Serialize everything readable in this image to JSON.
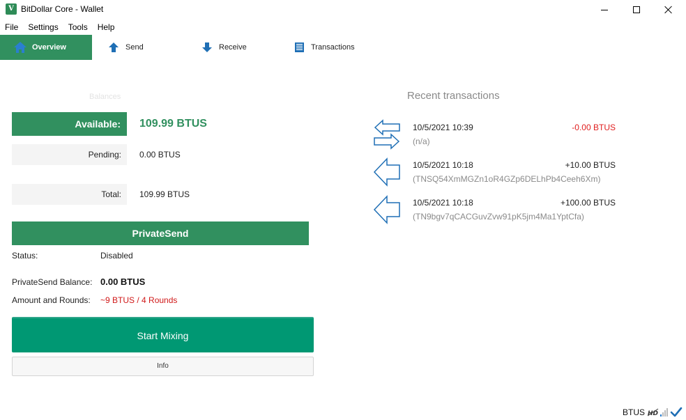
{
  "window": {
    "title": "BitDollar Core - Wallet",
    "app_icon_letter": "V"
  },
  "menu": {
    "items": [
      {
        "label": "File"
      },
      {
        "label": "Settings"
      },
      {
        "label": "Tools"
      },
      {
        "label": "Help"
      }
    ]
  },
  "toolbar": {
    "tabs": [
      {
        "label": "Overview",
        "icon": "home-icon",
        "active": true
      },
      {
        "label": "Send",
        "icon": "arrow-up-icon"
      },
      {
        "label": "Receive",
        "icon": "arrow-down-icon"
      },
      {
        "label": "Transactions",
        "icon": "list-icon"
      }
    ]
  },
  "balances": {
    "section_label": "Balances",
    "available_label": "Available:",
    "available_value": "109.99 BTUS",
    "pending_label": "Pending:",
    "pending_value": "0.00 BTUS",
    "total_label": "Total:",
    "total_value": "109.99 BTUS"
  },
  "privatesend": {
    "header": "PrivateSend",
    "status_label": "Status:",
    "status_value": "Disabled",
    "balance_label": "PrivateSend Balance:",
    "balance_value": "0.00 BTUS",
    "amount_rounds_label": "Amount and Rounds:",
    "amount_rounds_value": "~9 BTUS / 4 Rounds",
    "start_mixing_label": "Start Mixing",
    "info_label": "Info"
  },
  "recent": {
    "title": "Recent transactions",
    "transactions": [
      {
        "date": "10/5/2021 10:39",
        "amount": "-0.00 BTUS",
        "detail": "(n/a)",
        "icon": "payment-to-self-icon"
      },
      {
        "date": "10/5/2021 10:18",
        "amount": "+10.00 BTUS",
        "detail": "(TNSQ54XmMGZn1oR4GZp6DELhPb4Ceeh6Xm)",
        "icon": "received-arrow-icon"
      },
      {
        "date": "10/5/2021 10:18",
        "amount": "+100.00 BTUS",
        "detail": "(TN9bgv7qCACGuvZvw91pK5jm4Ma1YptCfa)",
        "icon": "received-arrow-icon"
      }
    ]
  },
  "statusbar": {
    "unit": "BTUS",
    "hd_label": "HD"
  },
  "colors": {
    "accent_green": "#31905f",
    "mix_button": "#009873",
    "negative": "#e01e1e",
    "icon_blue": "#1f6fb5"
  }
}
